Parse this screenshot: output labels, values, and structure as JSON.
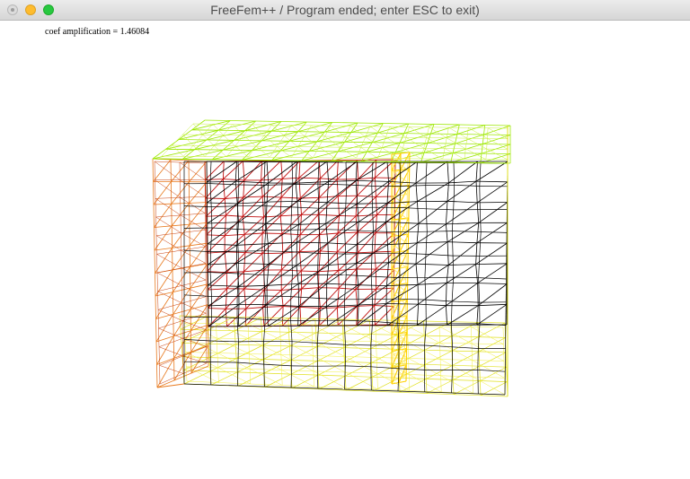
{
  "window": {
    "title": "FreeFem++ / Program ended; enter ESC to exit)"
  },
  "plot": {
    "coef_label": "coef amplification = 1.46084",
    "colors": {
      "top": "#9ce800",
      "top_light": "#c8f040",
      "left": "#e87a1e",
      "left_dark": "#c8400e",
      "bottom": "#e0e020",
      "bottom_light": "#f2f040",
      "front": "#000000",
      "inner": "#c01010",
      "band": "#ffd000",
      "band_light": "#ffe85a"
    }
  }
}
